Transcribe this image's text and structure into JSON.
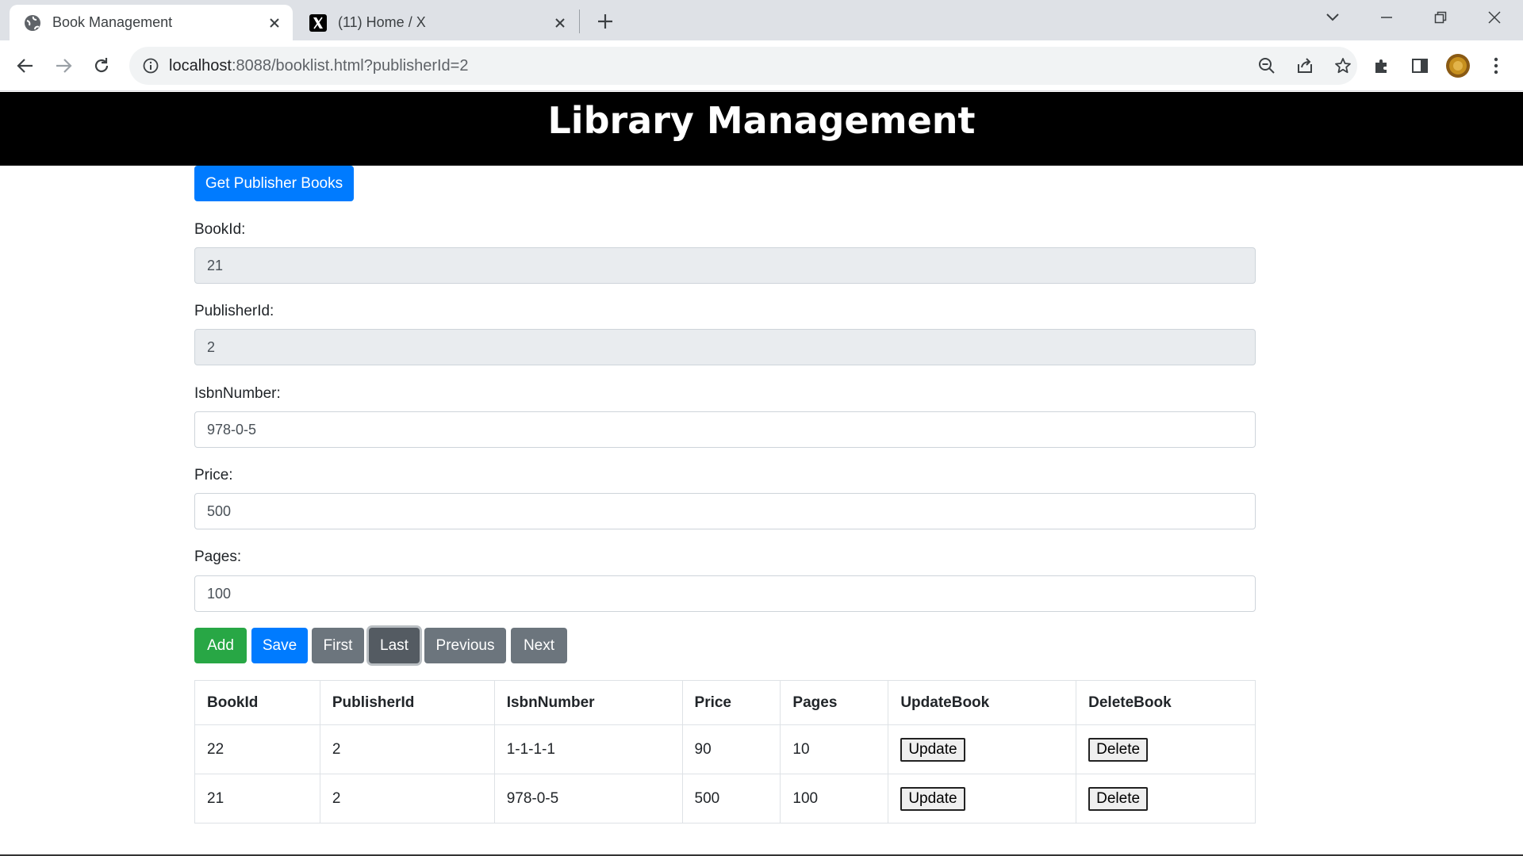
{
  "browser": {
    "tabs": [
      {
        "title": "Book Management",
        "active": true
      },
      {
        "title": "(11) Home / X",
        "active": false
      }
    ],
    "address": {
      "host": "localhost",
      "rest": ":8088/booklist.html?publisherId=2"
    }
  },
  "page": {
    "heading": "Library Management",
    "get_publisher_books_label": "Get Publisher Books",
    "form": {
      "bookid": {
        "label": "BookId:",
        "value": "21"
      },
      "publisherid": {
        "label": "PublisherId:",
        "value": "2"
      },
      "isbn": {
        "label": "IsbnNumber:",
        "value": "978-0-5"
      },
      "price": {
        "label": "Price:",
        "value": "500"
      },
      "pages": {
        "label": "Pages:",
        "value": "100"
      }
    },
    "actions": {
      "add": "Add",
      "save": "Save",
      "first": "First",
      "last": "Last",
      "previous": "Previous",
      "next": "Next"
    },
    "table": {
      "headers": [
        "BookId",
        "PublisherId",
        "IsbnNumber",
        "Price",
        "Pages",
        "UpdateBook",
        "DeleteBook"
      ],
      "rows": [
        {
          "bookid": "22",
          "publisherid": "2",
          "isbn": "1-1-1-1",
          "price": "90",
          "pages": "10",
          "update": "Update",
          "delete": "Delete"
        },
        {
          "bookid": "21",
          "publisherid": "2",
          "isbn": "978-0-5",
          "price": "500",
          "pages": "100",
          "update": "Update",
          "delete": "Delete"
        }
      ]
    }
  },
  "colors": {
    "primary": "#007bff",
    "success": "#28a745",
    "secondary": "#6c757d",
    "banner": "#000000"
  }
}
